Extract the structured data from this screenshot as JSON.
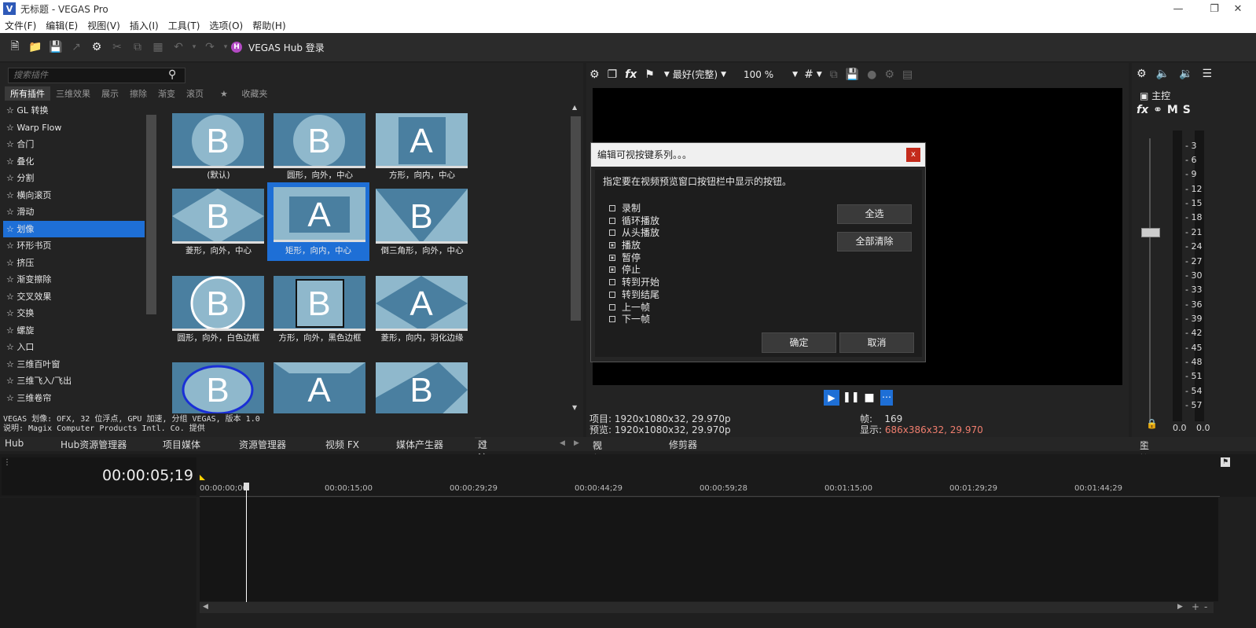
{
  "window": {
    "title": "无标题 - VEGAS Pro",
    "logo": "V"
  },
  "menu": [
    "文件(F)",
    "编辑(E)",
    "视图(V)",
    "插入(I)",
    "工具(T)",
    "选项(O)",
    "帮助(H)"
  ],
  "toolbar": {
    "hub_label": "VEGAS Hub 登录"
  },
  "plugins": {
    "search_placeholder": "搜索插件",
    "tabs": [
      "所有插件",
      "三维效果",
      "展示",
      "擦除",
      "渐变",
      "滚页",
      "收藏夹"
    ],
    "list": [
      "GL 转换",
      "Warp Flow",
      "合门",
      "叠化",
      "分割",
      "横向滚页",
      "滑动",
      "划像",
      "环形书页",
      "挤压",
      "渐变擦除",
      "交叉效果",
      "交换",
      "螺旋",
      "入口",
      "三维百叶窗",
      "三维飞入/飞出",
      "三维卷帘"
    ],
    "selected_index": 7,
    "presets": [
      "(默认)",
      "圆形，向外，中心",
      "方形，向内，中心",
      "菱形，向外，中心",
      "矩形，向内，中心",
      "倒三角形，向外，中心",
      "圆形，向外，白色边框",
      "方形，向外，黑色边框",
      "菱形，向内，羽化边缘"
    ],
    "info_line1": "VEGAS 划像: OFX, 32 位浮点, GPU 加速, 分组 VEGAS, 版本 1.0",
    "info_line2": "说明: Magix Computer Products Intl. Co. 提供"
  },
  "tabbar": {
    "hub": "Hub",
    "hub_explorer": "Hub资源管理器",
    "project_media": "项目媒体",
    "explorer": "资源管理器",
    "video_fx": "视频 FX",
    "media_gen": "媒体产生器",
    "transitions": "过渡特效",
    "video_preview": "视频预览",
    "trimmer": "修剪器",
    "master_bus": "主控总线"
  },
  "preview": {
    "quality": "最好(完整)",
    "zoom": "100 %",
    "project": "项目: 1920x1080x32, 29.970p",
    "preview": "预览: 1920x1080x32, 29.970p",
    "frame_label": "帧:",
    "frame_value": "169",
    "display_label": "显示:",
    "display_value": "686x386x32, 29.970"
  },
  "dialog": {
    "title": "编辑可视按键系列。。。",
    "close": "x",
    "instruction": "指定要在视频预览窗口按钮栏中显示的按钮。",
    "items": [
      {
        "label": "录制",
        "checked": false
      },
      {
        "label": "循环播放",
        "checked": false
      },
      {
        "label": "从头播放",
        "checked": false
      },
      {
        "label": "播放",
        "checked": true
      },
      {
        "label": "暂停",
        "checked": true
      },
      {
        "label": "停止",
        "checked": true
      },
      {
        "label": "转到开始",
        "checked": false
      },
      {
        "label": "转到结尾",
        "checked": false
      },
      {
        "label": "上一帧",
        "checked": false
      },
      {
        "label": "下一帧",
        "checked": false
      }
    ],
    "select_all": "全选",
    "clear_all": "全部清除",
    "ok": "确定",
    "cancel": "取消"
  },
  "mixer": {
    "master_label": "主控",
    "fx": "fx",
    "m": "M",
    "s": "S",
    "ticks": [
      "3",
      "6",
      "9",
      "12",
      "15",
      "18",
      "21",
      "24",
      "27",
      "30",
      "33",
      "36",
      "39",
      "42",
      "45",
      "48",
      "51",
      "54",
      "57"
    ],
    "left_level": "0.0",
    "right_level": "0.0"
  },
  "timeline": {
    "timecode": "00:00:05;19",
    "ruler": [
      "00:00:00;00",
      "00:00:15;00",
      "00:00:29;29",
      "00:00:44;29",
      "00:00:59;28",
      "00:01:15;00",
      "00:01:29;29",
      "00:01:44;29"
    ]
  }
}
